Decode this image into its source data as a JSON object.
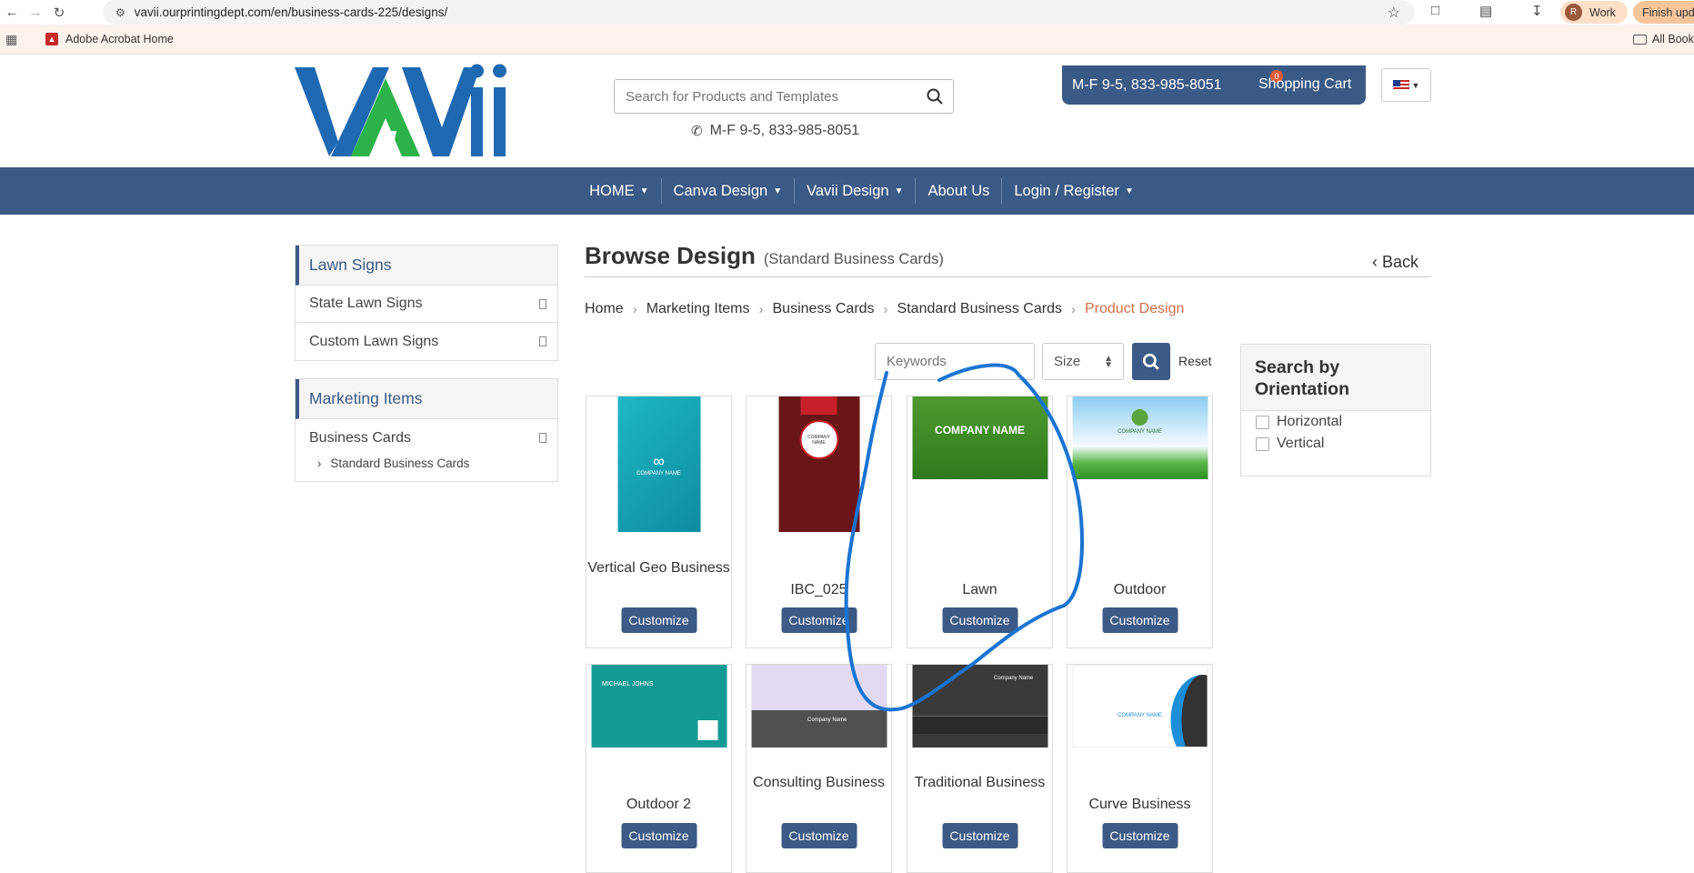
{
  "browser": {
    "url": "vavii.ourprintingdept.com/en/business-cards-225/designs/",
    "profile_initial": "R",
    "profile_label": "Work",
    "update_label": "Finish upd",
    "bookmark_1": "Adobe Acrobat Home",
    "bookmarks_all": "All Book"
  },
  "header": {
    "search_placeholder": "Search for Products and Templates",
    "phone_line": "M-F 9-5, 833-985-8051",
    "topbar_phone": "M-F 9-5, 833-985-8051",
    "cart_label": "Shopping Cart",
    "cart_count": "0"
  },
  "nav": {
    "items": [
      {
        "label": "HOME",
        "dropdown": true
      },
      {
        "label": "Canva Design",
        "dropdown": true
      },
      {
        "label": "Vavii Design",
        "dropdown": true
      },
      {
        "label": "About Us",
        "dropdown": false
      },
      {
        "label": "Login / Register",
        "dropdown": true
      }
    ]
  },
  "sidebar": {
    "panel1_title": "Lawn Signs",
    "panel1_rows": [
      "State Lawn Signs",
      "Custom Lawn Signs"
    ],
    "panel2_title": "Marketing Items",
    "panel2_rows": [
      "Business Cards"
    ],
    "panel2_sub": "Standard Business Cards"
  },
  "main": {
    "title": "Browse Design",
    "subtitle": "(Standard Business Cards)",
    "back_label": "Back",
    "breadcrumb": [
      "Home",
      "Marketing Items",
      "Business Cards",
      "Standard Business Cards",
      "Product Design"
    ],
    "keywords_placeholder": "Keywords",
    "size_label": "Size",
    "reset_label": "Reset",
    "orientation_title": "Search by Orientation",
    "orientation_options": [
      "Horizontal",
      "Vertical"
    ],
    "customize_label": "Customize",
    "cards": [
      {
        "name": "Vertical Geo Business",
        "thumb_text": "COMPANY NAME"
      },
      {
        "name": "IBC_025",
        "thumb_text": "COMPANY NAME"
      },
      {
        "name": "Lawn",
        "thumb_text": "COMPANY NAME"
      },
      {
        "name": "Outdoor",
        "thumb_text": "COMPANY NAME"
      },
      {
        "name": "Outdoor 2",
        "thumb_text": "MICHAEL JOHNS"
      },
      {
        "name": "Consulting Business",
        "thumb_text": "Company Name"
      },
      {
        "name": "Traditional Business",
        "thumb_text": "Company Name"
      },
      {
        "name": "Curve Business",
        "thumb_text": "COMPANY NAME"
      }
    ]
  },
  "colors": {
    "brand_blue": "#3b5a85",
    "breadcrumb_active": "#d0704c",
    "annotation_stroke": "#1a74d2"
  }
}
